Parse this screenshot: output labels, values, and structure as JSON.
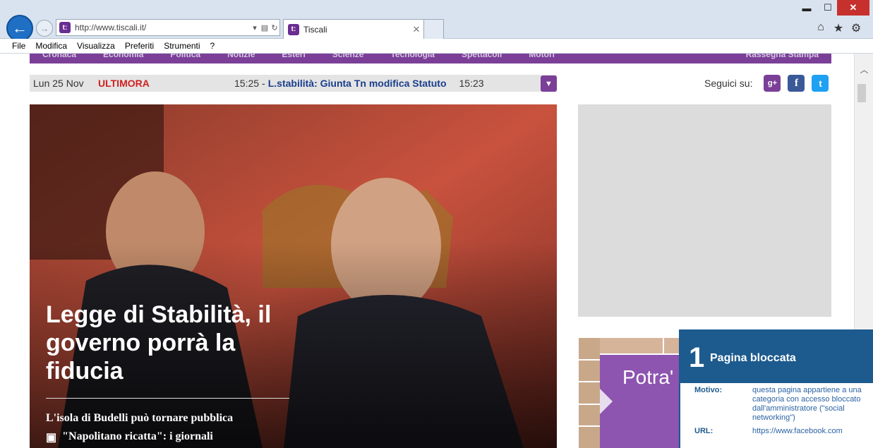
{
  "browser": {
    "address": "http://www.tiscali.it/",
    "site_icon": "t:",
    "tab_title": "Tiscali",
    "menu": [
      "File",
      "Modifica",
      "Visualizza",
      "Preferiti",
      "Strumenti",
      "?"
    ],
    "window_controls": {
      "minimize": "▬",
      "maximize": "☐",
      "close": "✕"
    },
    "toolbar_icons": {
      "home": "home-icon",
      "favorites": "star-icon",
      "tools": "gear-icon"
    }
  },
  "page": {
    "nav": [
      "Cronaca",
      "Economia",
      "Politica",
      "Notizie",
      "Esteri",
      "Scienze",
      "Tecnologia",
      "Spettacoli",
      "Motori"
    ],
    "nav_right": "Rassegna Stampa",
    "ticker": {
      "date": "Lun 25 Nov",
      "label": "ULTIMORA",
      "time": "15:25",
      "separator": "-",
      "headline": "L.stabilità: Giunta Tn modifica Statuto",
      "next_time": "15:23"
    },
    "social": {
      "label": "Seguici su:"
    },
    "hero": {
      "headline": "Legge di Stabilità, il governo porrà la fiducia",
      "sub1": "L'isola di Budelli può tornare pubblica",
      "sub2": "\"Napolitano ricatta\": i giornali"
    },
    "promo": {
      "text": "Potra' publ sul po"
    }
  },
  "blocked": {
    "number": "1",
    "title": "Pagina bloccata",
    "reason_label": "Motivo:",
    "reason_value": "questa pagina appartiene a una categoria con accesso bloccato dall'amministratore (\"social networking\")",
    "url_label": "URL:",
    "url_value": "https://www.facebook.com"
  },
  "colors": {
    "brand_purple": "#7b3f98",
    "ticker_red": "#d11f1f",
    "ticker_link": "#1a3e8c",
    "blocked_blue": "#1d5b8e"
  }
}
